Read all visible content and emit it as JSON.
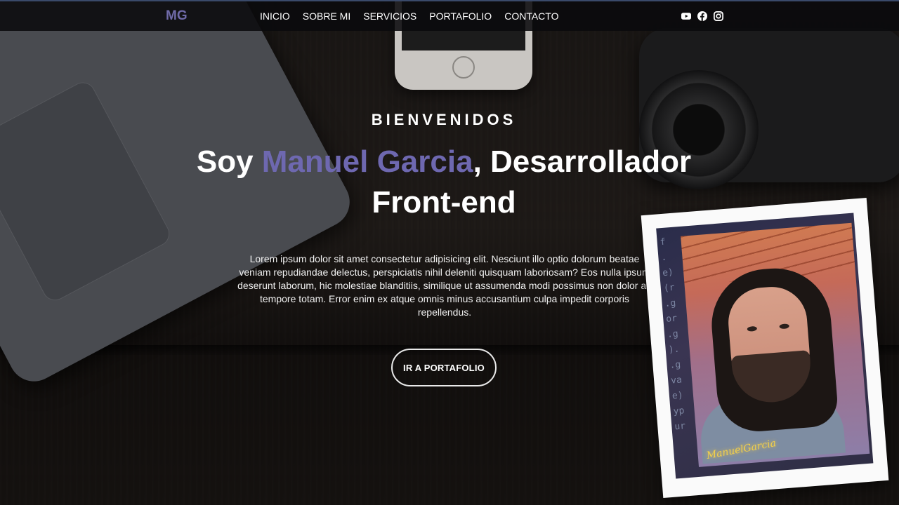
{
  "navbar": {
    "brand": "MG",
    "links": [
      "INICIO",
      "SOBRE MI",
      "SERVICIOS",
      "PORTAFOLIO",
      "CONTACTO"
    ],
    "social_icons": [
      "youtube-icon",
      "facebook-icon",
      "instagram-icon"
    ]
  },
  "hero": {
    "eyebrow": "BIENVENIDOS",
    "title_prefix": "Soy ",
    "title_name": "Manuel Garcia",
    "title_suffix": ", Desarrollador Front-end",
    "description": "Lorem ipsum dolor sit amet consectetur adipisicing elit. Nesciunt illo optio dolorum beatae veniam repudiandae delectus, perspiciatis nihil deleniti quisquam laboriosam? Eos nulla ipsum deserunt laborum, hic molestiae blanditiis, similique ut assumenda modi possimus non dolor ad tempore totam. Error enim ex atque omnis minus accusantium culpa impedit corporis repellendus.",
    "cta_label": "IR A PORTAFOLIO"
  },
  "profile": {
    "signature": "ManuelGarcia"
  },
  "colors": {
    "accent": "#6e68b0",
    "navbar_bg": "#0a0a0c",
    "text": "#ffffff",
    "signature": "#f3d04a"
  }
}
